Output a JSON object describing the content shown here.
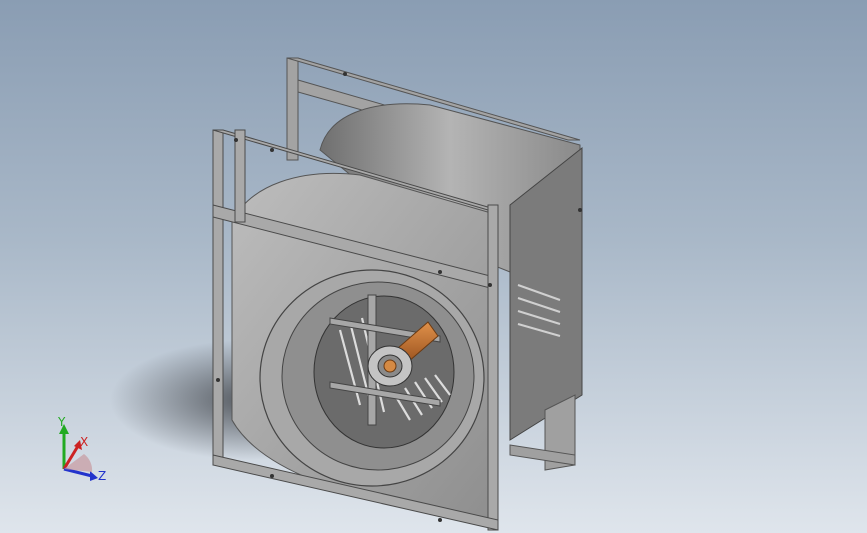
{
  "viewport": {
    "background_top": "#8a9db3",
    "background_bottom": "#dfe5ec",
    "model": "centrifugal-fan-assembly"
  },
  "colors": {
    "housing": "#9a9a9a",
    "frame": "#a6a6a6",
    "shaft": "#c8742f",
    "axis_x": "#cc2222",
    "axis_y": "#22aa22",
    "axis_z": "#2233cc"
  },
  "triad": {
    "x_label": "X",
    "y_label": "Y",
    "z_label": "Z"
  }
}
